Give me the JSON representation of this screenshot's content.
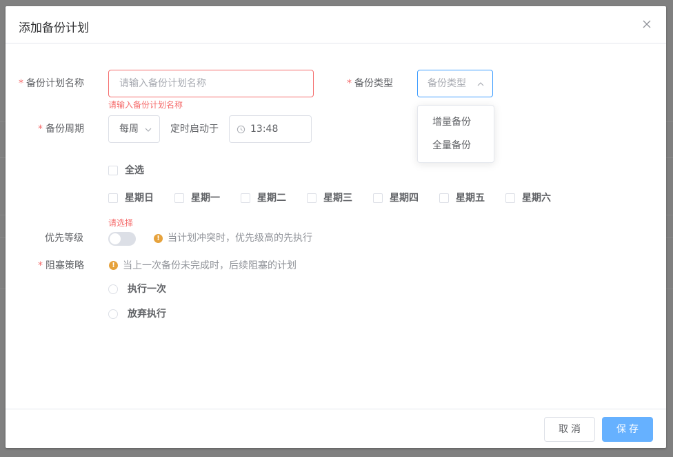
{
  "dialog": {
    "title": "添加备份计划"
  },
  "form": {
    "plan_name": {
      "label": "备份计划名称",
      "placeholder": "请输入备份计划名称",
      "error": "请输入备份计划名称"
    },
    "backup_type": {
      "label": "备份类型",
      "placeholder": "备份类型",
      "options": [
        "增量备份",
        "全量备份"
      ]
    },
    "cycle": {
      "label": "备份周期",
      "value": "每周",
      "timer_label": "定时启动于",
      "time": "13:48"
    },
    "weekdays": {
      "select_all": "全选",
      "days": [
        "星期日",
        "星期一",
        "星期二",
        "星期三",
        "星期四",
        "星期五",
        "星期六"
      ],
      "error": "请选择"
    },
    "priority": {
      "label": "优先等级",
      "enabled": false,
      "hint": "当计划冲突时，优先级高的先执行"
    },
    "blocking": {
      "label": "阻塞策略",
      "hint": "当上一次备份未完成时，后续阻塞的计划",
      "options": [
        "执行一次",
        "放弃执行"
      ]
    }
  },
  "footer": {
    "cancel": "取消",
    "save": "保存"
  },
  "colors": {
    "primary": "#409eff",
    "danger": "#f56c6c",
    "warning": "#e6a23c",
    "save_button": "#66b1ff"
  }
}
